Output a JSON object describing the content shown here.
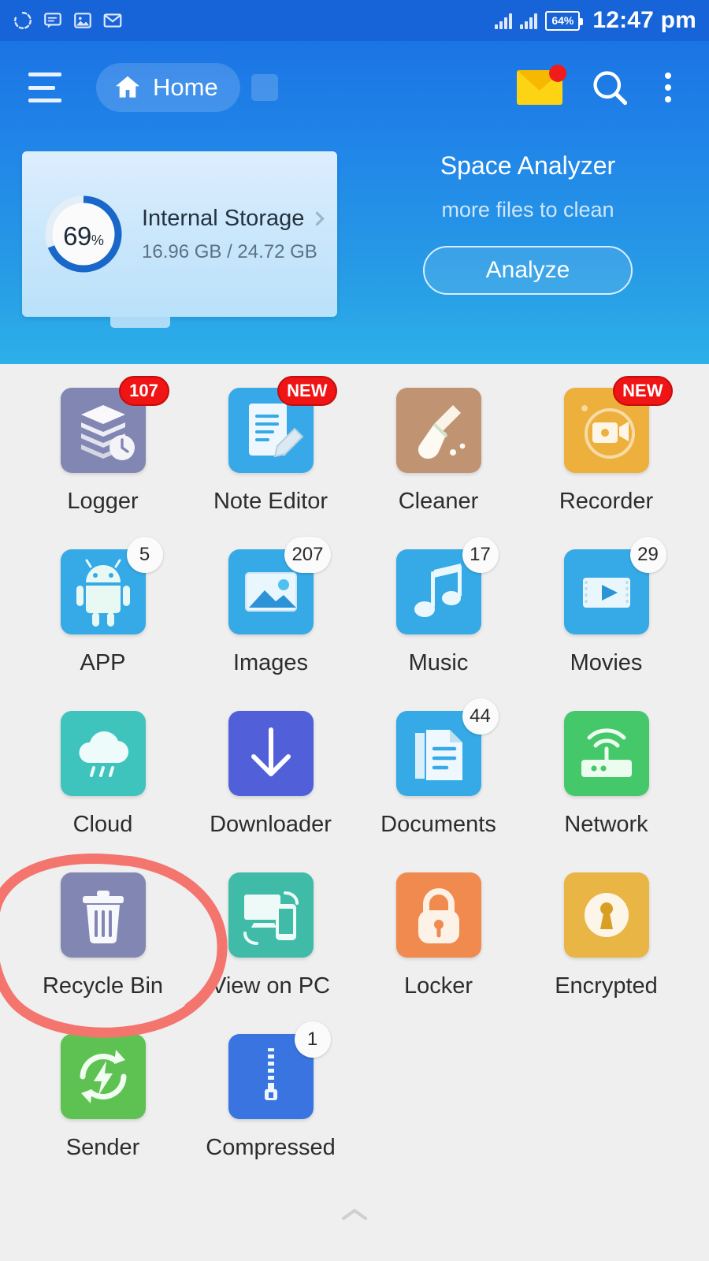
{
  "status_bar": {
    "icons": [
      "sync-icon",
      "message-icon",
      "image-icon",
      "email-icon"
    ],
    "battery_percent": "64%",
    "time": "12:47 pm"
  },
  "app_bar": {
    "menu_icon": "hamburger-menu-icon",
    "home_tab_label": "Home",
    "home_icon": "home-icon",
    "mail_icon": "mail-icon",
    "search_icon": "search-icon",
    "overflow_icon": "more-vertical-icon"
  },
  "storage_card": {
    "percent": "69",
    "percent_symbol": "%",
    "title": "Internal Storage",
    "usage": "16.96 GB / 24.72 GB",
    "chevron_icon": "chevron-right-icon",
    "ring_color": "#1967c8",
    "used_fraction": 0.69
  },
  "analyzer": {
    "title": "Space Analyzer",
    "subtitle": "more files to clean",
    "button_label": "Analyze"
  },
  "grid": {
    "items": [
      {
        "label": "Logger",
        "icon": "logger-icon",
        "badge": "107",
        "badge_style": "red",
        "color": "#8286b2"
      },
      {
        "label": "Note Editor",
        "icon": "note-editor-icon",
        "badge": "NEW",
        "badge_style": "red",
        "color": "#37a8e8"
      },
      {
        "label": "Cleaner",
        "icon": "broom-icon",
        "badge": "",
        "badge_style": "",
        "color": "#c09372"
      },
      {
        "label": "Recorder",
        "icon": "video-camera-icon",
        "badge": "NEW",
        "badge_style": "red",
        "color": "#edb03c"
      },
      {
        "label": "APP",
        "icon": "android-icon",
        "badge": "5",
        "badge_style": "white",
        "color": "#35aae6"
      },
      {
        "label": "Images",
        "icon": "photo-icon",
        "badge": "207",
        "badge_style": "white",
        "color": "#35aae6"
      },
      {
        "label": "Music",
        "icon": "music-note-icon",
        "badge": "17",
        "badge_style": "white",
        "color": "#35aae6"
      },
      {
        "label": "Movies",
        "icon": "film-play-icon",
        "badge": "29",
        "badge_style": "white",
        "color": "#35aae6"
      },
      {
        "label": "Cloud",
        "icon": "cloud-icon",
        "badge": "",
        "badge_style": "",
        "color": "#3fc4bd"
      },
      {
        "label": "Downloader",
        "icon": "download-arrow-icon",
        "badge": "",
        "badge_style": "",
        "color": "#5160d8"
      },
      {
        "label": "Documents",
        "icon": "document-icon",
        "badge": "44",
        "badge_style": "white",
        "color": "#35aae6"
      },
      {
        "label": "Network",
        "icon": "router-wifi-icon",
        "badge": "",
        "badge_style": "",
        "color": "#45c86a"
      },
      {
        "label": "Recycle Bin",
        "icon": "trash-icon",
        "badge": "",
        "badge_style": "",
        "color": "#8286b2"
      },
      {
        "label": "View on PC",
        "icon": "pc-phone-sync-icon",
        "badge": "",
        "badge_style": "",
        "color": "#3fbba8"
      },
      {
        "label": "Locker",
        "icon": "padlock-icon",
        "badge": "",
        "badge_style": "",
        "color": "#f08a4e"
      },
      {
        "label": "Encrypted",
        "icon": "keyhole-icon",
        "badge": "",
        "badge_style": "",
        "color": "#e9b545"
      },
      {
        "label": "Sender",
        "icon": "sync-bolt-icon",
        "badge": "",
        "badge_style": "",
        "color": "#5ec252"
      },
      {
        "label": "Compressed",
        "icon": "zipper-icon",
        "badge": "1",
        "badge_style": "white",
        "color": "#3a74e0"
      }
    ]
  },
  "annotation": {
    "shape": "hand-drawn-circle",
    "color": "#f4746e",
    "target": "Recycle Bin"
  },
  "bottom_handle": {
    "icon": "chevron-up-icon"
  }
}
